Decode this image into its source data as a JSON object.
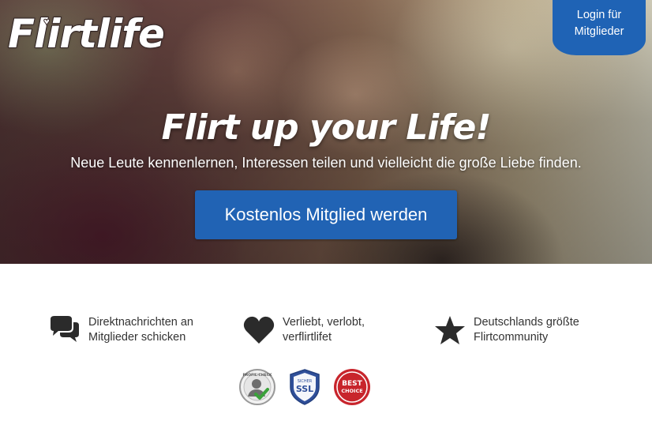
{
  "brand": {
    "logo_text": "Flirtlife",
    "logo_icon": "heart-icon"
  },
  "header": {
    "login_line1": "Login für",
    "login_line2": "Mitglieder"
  },
  "hero": {
    "headline": "Flirt up your Life!",
    "subline": "Neue Leute kennenlernen, Interessen teilen und vielleicht die große Liebe finden.",
    "cta_label": "Kostenlos Mitglied werden"
  },
  "features": [
    {
      "icon": "chat-bubbles-icon",
      "line1": "Direktnachrichten an",
      "line2": "Mitglieder schicken"
    },
    {
      "icon": "heart-icon",
      "line1": "Verliebt, verlobt,",
      "line2": "verflirtlifet"
    },
    {
      "icon": "star-icon",
      "line1": "Deutschlands größte",
      "line2": "Flirtcommunity"
    }
  ],
  "badges": {
    "profile_check": {
      "icon": "profile-check-badge-icon",
      "text": "PROFIL-CHECK"
    },
    "ssl": {
      "icon": "ssl-shield-badge-icon",
      "top": "SICHER",
      "main": "SSL"
    },
    "best_choice": {
      "icon": "best-choice-badge-icon",
      "line1": "BEST",
      "line2": "CHOICE"
    }
  },
  "colors": {
    "primary": "#2163b4",
    "text": "#333333",
    "icon": "#2b2b2b",
    "best_choice_red": "#c8252c"
  }
}
